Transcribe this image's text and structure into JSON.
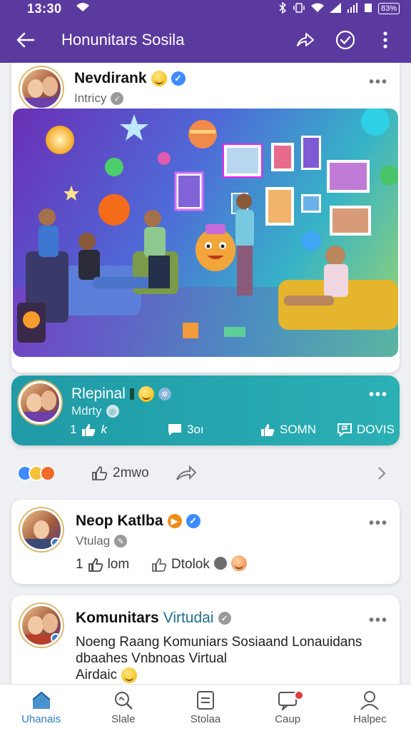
{
  "status_bar": {
    "time": "13:30",
    "battery": "83%"
  },
  "app_bar": {
    "title": "Honunitars Sosila"
  },
  "post1": {
    "author": "Nevdirank",
    "subtitle": "Intricy"
  },
  "post2": {
    "author": "Rlepinal",
    "subtitle": "Mdrty",
    "likes": "1",
    "comments": "3oı",
    "shares": "SOMN",
    "views": "DOVIS"
  },
  "reactions": {
    "count": "2mwo"
  },
  "post3": {
    "author": "Neop Katlba",
    "subtitle": "Vtulag",
    "likes": "1",
    "like_label": "lom",
    "action_label": "Dtolok"
  },
  "post4": {
    "author_part1": "Komunitars",
    "author_part2": "Virtudai",
    "body_line1": "Noeng Raang Komuniars Sosiaand Lonauidans",
    "body_line2": "dbaahes Vnbnoas Virtual",
    "body_line3": "Airdaic"
  },
  "nav": [
    {
      "label": "Uhanais",
      "icon": "home-icon"
    },
    {
      "label": "Slale",
      "icon": "search-icon"
    },
    {
      "label": "Stolaa",
      "icon": "document-icon"
    },
    {
      "label": "Caup",
      "icon": "chat-icon"
    },
    {
      "label": "Halpec",
      "icon": "profile-icon"
    }
  ],
  "colors": {
    "app_bar": "#5b3aa0",
    "teal_card": "#1f9aa6",
    "nav_active": "#2a7fc4"
  }
}
